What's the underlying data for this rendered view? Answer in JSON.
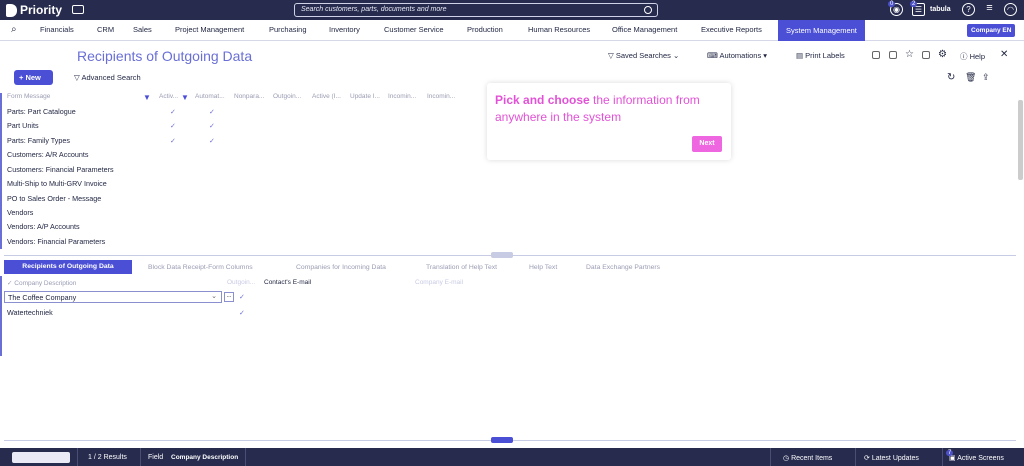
{
  "app": {
    "logo_label": "Priority",
    "user_name": "tabula",
    "company_label": "Company EN"
  },
  "search": {
    "placeholder": "Search customers, parts, documents and more"
  },
  "badges": {
    "notifications": "0",
    "tasks": "2"
  },
  "menu": {
    "items": [
      "Financials",
      "CRM",
      "Sales",
      "Project Management",
      "Purchasing",
      "Inventory",
      "Customer Service",
      "Production",
      "Human Resources",
      "Office Management",
      "Executive Reports",
      "System Management"
    ],
    "active": "System Management"
  },
  "form": {
    "title": "Recipients of Outgoing Data",
    "saved_searches": "Saved Searches",
    "automations": "Automations",
    "print_labels": "Print Labels",
    "help": "Help",
    "new_button": "New",
    "advanced_search": "Advanced Search"
  },
  "upper_table": {
    "headers": [
      "Form Message",
      "Activ...",
      "Automat...",
      "Nonpara...",
      "Outgoin...",
      "Active (I...",
      "Update I...",
      "Incomin...",
      "Incomin..."
    ],
    "rows": [
      {
        "name": "Parts: Part Catalogue",
        "active": "✓",
        "auto": "✓"
      },
      {
        "name": "Part Units",
        "active": "✓",
        "auto": "✓"
      },
      {
        "name": "Parts: Family Types",
        "active": "✓",
        "auto": "✓"
      },
      {
        "name": "Customers: A/R Accounts",
        "active": "",
        "auto": ""
      },
      {
        "name": "Customers: Financial Parameters",
        "active": "",
        "auto": ""
      },
      {
        "name": "Multi-Ship to Multi-GRV Invoice",
        "active": "",
        "auto": ""
      },
      {
        "name": "PO to Sales Order - Message",
        "active": "",
        "auto": ""
      },
      {
        "name": "Vendors",
        "active": "",
        "auto": ""
      },
      {
        "name": "Vendors: A/P Accounts",
        "active": "",
        "auto": ""
      },
      {
        "name": "Vendors: Financial Parameters",
        "active": "",
        "auto": ""
      }
    ]
  },
  "popup": {
    "highlight": "Pick and choose",
    "message": " the information from anywhere in the system",
    "next": "Next"
  },
  "subtabs": [
    "Recipients of Outgoing Data",
    "Block Data Receipt-Form Columns",
    "Companies for Incoming Data",
    "Translation of Help Text",
    "Help Text",
    "Data Exchange Partners"
  ],
  "lower_table": {
    "headers": [
      "Company Description",
      "Outgoin...",
      "Contact's E-mail",
      "Company E-mail"
    ],
    "rows": [
      {
        "name": "The Coffee Company",
        "outgoing": "✓"
      },
      {
        "name": "Watertechniek",
        "outgoing": "✓"
      }
    ],
    "dots": "..."
  },
  "footer": {
    "results": "1 / 2 Results",
    "field_label": "Field",
    "field_value": "Company Description",
    "recent": "Recent Items",
    "latest": "Latest Updates",
    "active_screens": "Active Screens",
    "active_count": "7"
  }
}
